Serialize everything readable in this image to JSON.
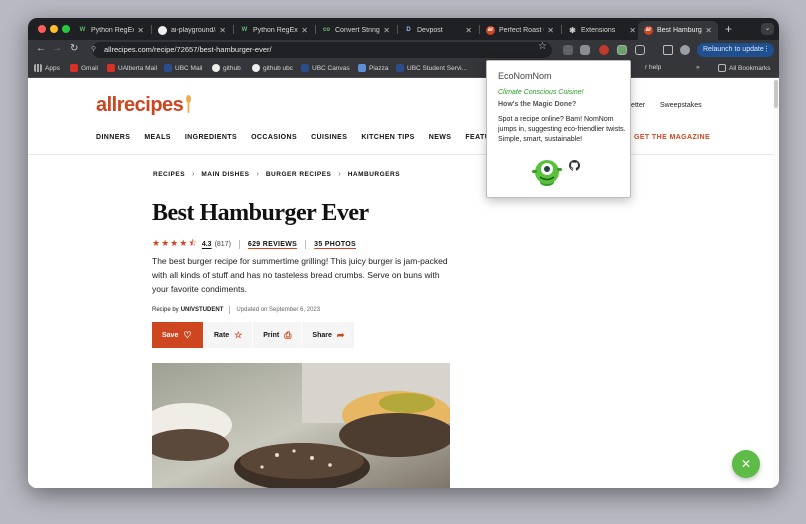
{
  "browser": {
    "tabs": [
      {
        "title": "Python RegEx",
        "favicon": "W",
        "active": false
      },
      {
        "title": "ai-playground/a",
        "favicon": "github-icon",
        "active": false
      },
      {
        "title": "Python RegEx",
        "favicon": "W",
        "active": false
      },
      {
        "title": "Convert String",
        "favicon": "co",
        "active": false
      },
      {
        "title": "Devpost",
        "favicon": "D",
        "active": false
      },
      {
        "title": "Perfect Roast C",
        "favicon": "ar",
        "active": false
      },
      {
        "title": "Extensions",
        "favicon": "puzzle-icon",
        "active": false
      },
      {
        "title": "Best Hamburger",
        "favicon": "ar",
        "active": true
      }
    ],
    "new_tab_label": "+",
    "address": "allrecipes.com/recipe/72657/best-hamburger-ever/",
    "relaunch_label": "Relaunch to update",
    "bookmarks": [
      "Apps",
      "Gmail",
      "UAlberta Mail",
      "UBC Mail",
      "github",
      "github ubc",
      "UBC Canvas",
      "Piazza",
      "UBC Student Servi...",
      "r help"
    ],
    "all_bookmarks_label": "All Bookmarks"
  },
  "site": {
    "logo": "allrecipes",
    "top_links": [
      "sletter",
      "Sweepstakes"
    ],
    "nav": [
      "DINNERS",
      "MEALS",
      "INGREDIENTS",
      "OCCASIONS",
      "CUISINES",
      "KITCHEN TIPS",
      "NEWS",
      "FEATURES"
    ],
    "get_magazine": "GET THE MAGAZINE"
  },
  "recipe": {
    "breadcrumbs": [
      "RECIPES",
      "MAIN DISHES",
      "BURGER RECIPES",
      "HAMBURGERS"
    ],
    "title": "Best Hamburger Ever",
    "rating": "4.3",
    "rating_count": "(817)",
    "rating_fraction": 0.86,
    "reviews_label": "629 REVIEWS",
    "photos_label": "35 PHOTOS",
    "description": "The best burger recipe for summertime grilling! This juicy burger is jam-packed with all kinds of stuff and has no tasteless bread crumbs. Serve on buns with your favorite condiments.",
    "recipe_by_label": "Recipe by",
    "author": "UNIVSTUDENT",
    "updated": "Updated on September 6, 2023",
    "actions": {
      "save": "Save",
      "rate": "Rate",
      "print": "Print",
      "share": "Share"
    }
  },
  "popup": {
    "name": "EcoNomNom",
    "tagline": "Climate Conscious Cuisine!",
    "question": "How's the Magic Done?",
    "body": "Spot a recipe online? Bam! NomNom jumps in, suggesting eco-friendlier twists. Simple, smart, sustainable!"
  },
  "colors": {
    "brand": "#ce4620",
    "fab": "#5dbb46",
    "popup_tagline": "#2a9b2a"
  }
}
